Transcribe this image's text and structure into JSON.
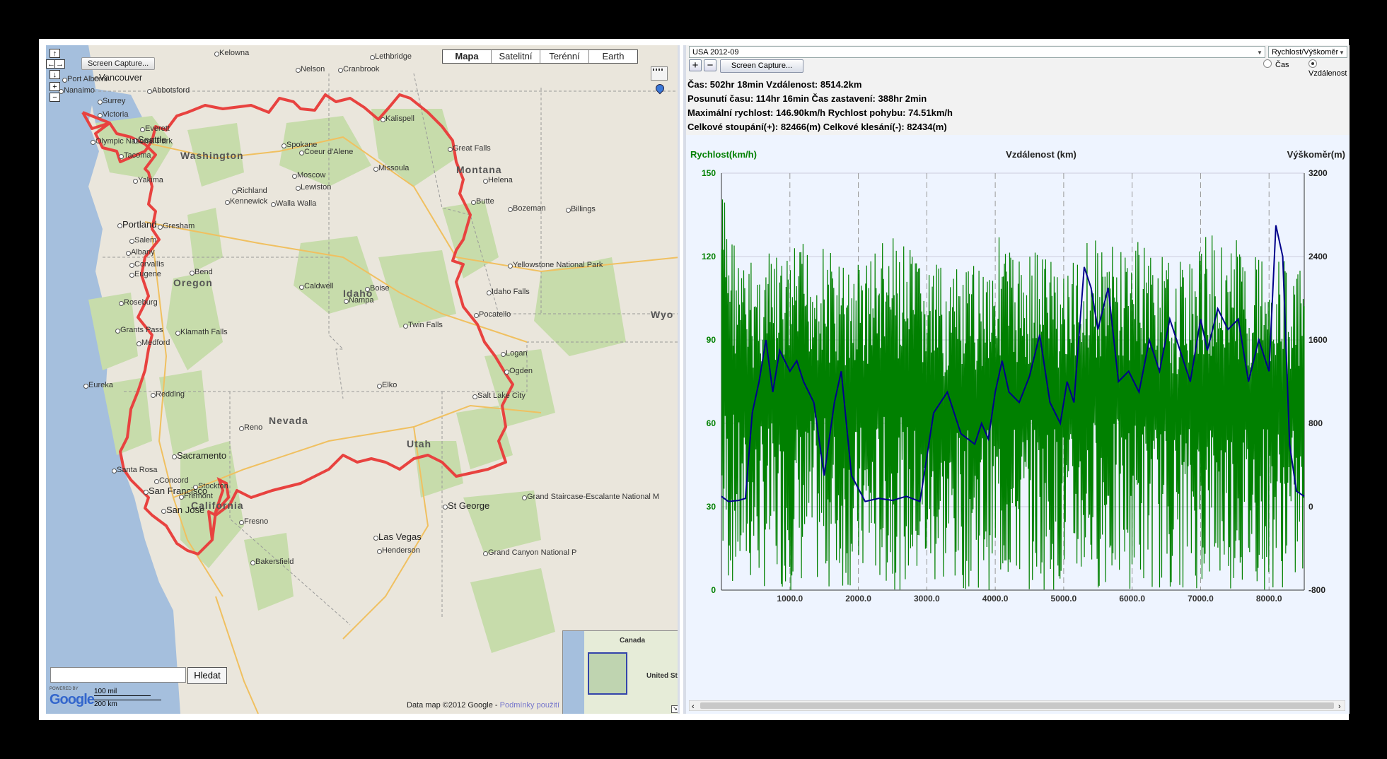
{
  "map": {
    "screen_capture_label": "Screen Capture...",
    "map_types": [
      "Mapa",
      "Satelitní",
      "Terénní",
      "Earth"
    ],
    "selected_map_type": "Mapa",
    "states": [
      "Washington",
      "Montana",
      "Oregon",
      "Idaho",
      "Nevada",
      "Utah",
      "California",
      "Wyo"
    ],
    "cities": [
      "Kelowna",
      "Lethbridge",
      "Nelson",
      "Cranbrook",
      "Vancouver",
      "Port Alberni",
      "Nanaimo",
      "Abbotsford",
      "Surrey",
      "Victoria",
      "Everett",
      "Seattle",
      "Olympic National Park",
      "Tacoma",
      "Spokane",
      "Coeur d'Alene",
      "Kalispell",
      "Great Falls",
      "Missoula",
      "Helena",
      "Moscow",
      "Lewiston",
      "Yakima",
      "Richland",
      "Kennewick",
      "Walla Walla",
      "Butte",
      "Bozeman",
      "Billings",
      "Portland",
      "Gresham",
      "Salem",
      "Albany",
      "Corvallis",
      "Eugene",
      "Bend",
      "Yellowstone National Park",
      "Caldwell",
      "Boise",
      "Nampa",
      "Idaho Falls",
      "Roseburg",
      "Pocatello",
      "Twin Falls",
      "Grants Pass",
      "Klamath Falls",
      "Medford",
      "Logan",
      "Ogden",
      "Eureka",
      "Redding",
      "Elko",
      "Salt Lake City",
      "Reno",
      "Sacramento",
      "Santa Rosa",
      "Concord",
      "Stockton",
      "San Francisco",
      "Fremont",
      "San Jose",
      "Fresno",
      "St George",
      "Grand Staircase-Escalante National M",
      "Las Vegas",
      "Henderson",
      "Grand Canyon National P",
      "Bakersfield",
      "Canada",
      "United St"
    ],
    "search_button": "Hledat",
    "search_value": "",
    "powered_by": "POWERED BY",
    "google_logo": "Google",
    "scale_miles": "100 mil",
    "scale_km": "200 km",
    "copyright": "Data map ©2012 Google - ",
    "copyright_link": "Podmínky použití"
  },
  "chart_panel": {
    "dataset_select": "USA 2012-09",
    "view_select": "Rychlost/Výškoměr",
    "screen_capture_label": "Screen Capture...",
    "zoom_in": "+",
    "zoom_out": "−",
    "radio_time": "Čas",
    "radio_distance": "Vzdálenost",
    "selected_axis": "Vzdálenost",
    "stats": [
      "Čas: 502hr 18min  Vzdálenost: 8514.2km",
      "Posunutí času: 114hr 16min  Čas zastavení: 388hr 2min",
      "Maximální rychlost: 146.90km/h  Rychlost pohybu: 74.51km/h",
      "Celkové stoupání(+): 82466(m)  Celkové klesání(-): 82434(m)"
    ]
  },
  "colors": {
    "speed": "#008000",
    "altitude": "#00008b",
    "route": "#e8423f",
    "chart_bg": "#eef4ff"
  },
  "chart_data": {
    "type": "line",
    "title": "",
    "xlabel": "Vzdálenost (km)",
    "ylabel": "Rychlost(km/h)",
    "y2label": "Výškoměr(m)",
    "xlim": [
      0,
      8514.2
    ],
    "ylim": [
      0,
      150
    ],
    "y2lim": [
      -800,
      3200
    ],
    "x_ticks": [
      "1000.0",
      "2000.0",
      "3000.0",
      "4000.0",
      "5000.0",
      "6000.0",
      "7000.0",
      "8000.0"
    ],
    "y_ticks": [
      "0",
      "30",
      "60",
      "90",
      "120",
      "150"
    ],
    "y2_ticks": [
      "-800",
      "0",
      "800",
      "1600",
      "2400",
      "3200"
    ],
    "grid": true,
    "series": [
      {
        "name": "Rychlost(km/h)",
        "axis": "left",
        "envelope_x": [
          0,
          300,
          600,
          900,
          1200,
          1500,
          1800,
          2100,
          2400,
          2700,
          3000,
          3300,
          3600,
          3900,
          4100,
          4300,
          4600,
          4900,
          5100,
          5300,
          5600,
          5900,
          6200,
          6500,
          6800,
          7100,
          7400,
          7700,
          8000,
          8300,
          8514
        ],
        "envelope_high": [
          148,
          118,
          122,
          120,
          126,
          125,
          118,
          122,
          128,
          124,
          118,
          116,
          115,
          125,
          130,
          120,
          126,
          122,
          116,
          130,
          125,
          124,
          128,
          118,
          120,
          128,
          130,
          122,
          125,
          118,
          115
        ],
        "envelope_low": [
          0,
          0,
          0,
          0,
          0,
          0,
          0,
          0,
          0,
          0,
          0,
          0,
          0,
          0,
          0,
          0,
          0,
          0,
          0,
          0,
          0,
          0,
          0,
          0,
          0,
          0,
          0,
          0,
          0,
          0,
          0
        ]
      },
      {
        "name": "Výškoměr(m)",
        "axis": "right",
        "x": [
          0,
          100,
          250,
          350,
          450,
          550,
          650,
          750,
          850,
          1000,
          1100,
          1200,
          1350,
          1500,
          1650,
          1750,
          1900,
          2100,
          2300,
          2500,
          2700,
          2900,
          3100,
          3300,
          3500,
          3700,
          3800,
          3900,
          4000,
          4100,
          4200,
          4350,
          4500,
          4650,
          4800,
          4950,
          5050,
          5150,
          5300,
          5400,
          5500,
          5650,
          5800,
          5950,
          6100,
          6250,
          6400,
          6550,
          6700,
          6850,
          7000,
          7100,
          7250,
          7400,
          7550,
          7700,
          7850,
          8000,
          8100,
          8200,
          8300,
          8400,
          8514
        ],
        "values": [
          100,
          50,
          60,
          80,
          900,
          1200,
          1600,
          1100,
          1500,
          1300,
          1400,
          1200,
          1000,
          300,
          1000,
          1300,
          300,
          50,
          80,
          60,
          100,
          50,
          900,
          1100,
          700,
          600,
          800,
          650,
          1100,
          1400,
          1100,
          1000,
          1250,
          1650,
          1000,
          800,
          1200,
          1000,
          2300,
          2100,
          1700,
          2100,
          1200,
          1300,
          1100,
          1600,
          1300,
          1800,
          1500,
          1200,
          1800,
          1500,
          1900,
          1700,
          1800,
          1200,
          1600,
          1300,
          2700,
          2400,
          600,
          150,
          100
        ]
      }
    ]
  }
}
